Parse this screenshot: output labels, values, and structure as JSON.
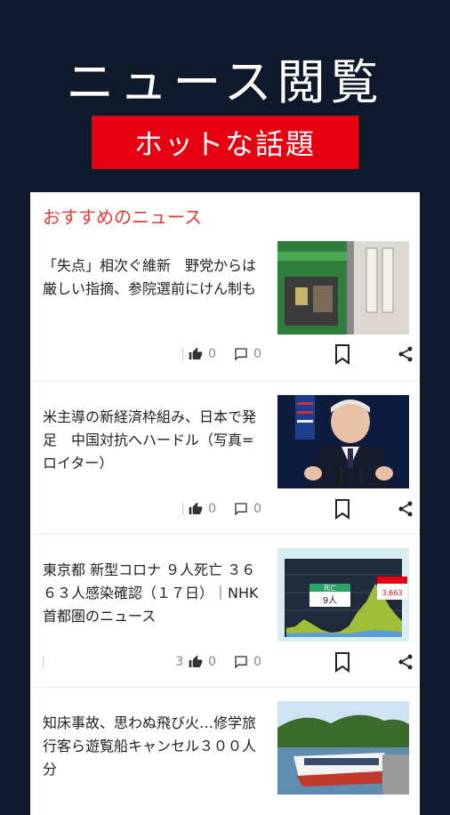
{
  "hero": {
    "title": "ニュース閲覧",
    "tag": "ホットな話題"
  },
  "section": {
    "title": "おすすめのニュース"
  },
  "articles": [
    {
      "headline": "「失点」相次ぐ維新　野党からは厳しい指摘、参院選前にけん制も",
      "likes": "0",
      "comments": "0",
      "views": ""
    },
    {
      "headline": "米主導の新経済枠組み、日本で発足　中国対抗へハードル（写真=ロイター）",
      "likes": "0",
      "comments": "0",
      "views": ""
    },
    {
      "headline": "東京都 新型コロナ ９人死亡 ３６６３人感染確認（１７日）｜NHK 首都圏のニュース",
      "likes": "0",
      "comments": "0",
      "views": "3",
      "thumb_labels": [
        "死亡",
        "9人",
        "3,663"
      ]
    },
    {
      "headline": "知床事故、思わぬ飛び火…修学旅行客ら遊覧船キャンセル３００人分",
      "likes": "",
      "comments": "",
      "views": ""
    }
  ],
  "colors": {
    "background": "#0e1a2c",
    "accent": "#e60012",
    "section_title": "#e53935"
  },
  "icons": [
    "thumbs-up-icon",
    "comment-icon",
    "bookmark-icon",
    "share-icon"
  ]
}
